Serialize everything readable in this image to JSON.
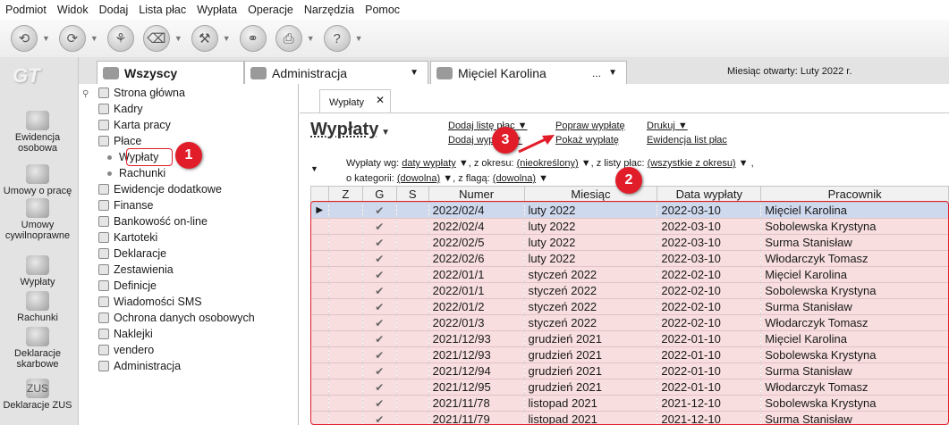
{
  "menu": [
    "Podmiot",
    "Widok",
    "Dodaj",
    "Lista płac",
    "Wypłata",
    "Operacje",
    "Narzędzia",
    "Pomoc"
  ],
  "toolbar_icons": [
    "back-icon",
    "forward-icon",
    "stamp-icon",
    "eraser-icon",
    "tools-icon",
    "link-icon",
    "printer-icon",
    "help-icon"
  ],
  "logo": "GT",
  "left_items": [
    "Ewidencja osobowa",
    "Umowy o pracę",
    "Umowy cywilnoprawne",
    "Wypłaty",
    "Rachunki",
    "Deklaracje skarbowe",
    "Deklaracje ZUS"
  ],
  "left_icon_texts": [
    "",
    "",
    "",
    "",
    "",
    "",
    "ZUS"
  ],
  "tabs": {
    "all": "Wszyscy",
    "admin": "Administracja",
    "person": "Mięciel Karolina",
    "person_more": "...",
    "month": "Miesiąc otwarty: Luty 2022 r."
  },
  "nav": [
    "Strona główna",
    "Kadry",
    "Karta pracy",
    "Płace",
    "Wypłaty",
    "Rachunki",
    "Ewidencje dodatkowe",
    "Finanse",
    "Bankowość on-line",
    "Kartoteki",
    "Deklaracje",
    "Zestawienia",
    "Definicje",
    "Wiadomości SMS",
    "Ochrona danych osobowych",
    "Naklejki",
    "vendero",
    "Administracja"
  ],
  "doc_tab": "Wypłaty",
  "page_title": "Wypłaty",
  "actions": {
    "add_list": "Dodaj listę płac",
    "add_pay": "Dodaj wypłatę",
    "fix_pay": "Popraw wypłatę",
    "show_pay": "Pokaż wypłatę",
    "print": "Drukuj",
    "registry": "Ewidencja list płac"
  },
  "filters": {
    "by_label": "Wypłaty wg:",
    "by_value": "daty wypłaty",
    "period_label": ", z okresu:",
    "period_value": "(nieokreślony)",
    "list_label": ", z listy płac:",
    "list_value": "(wszystkie z okresu)",
    "cat_label": "o kategorii:",
    "cat_value": "(dowolna)",
    "flag_label": ", z flagą:",
    "flag_value": "(dowolna)"
  },
  "columns": [
    "Z",
    "G",
    "S",
    "Numer",
    "Miesiąc",
    "Data wypłaty",
    "Pracownik"
  ],
  "rows": [
    [
      "2022/02/4",
      "luty 2022",
      "2022-03-10",
      "Mięciel Karolina"
    ],
    [
      "2022/02/4",
      "luty 2022",
      "2022-03-10",
      "Sobolewska Krystyna"
    ],
    [
      "2022/02/5",
      "luty 2022",
      "2022-03-10",
      "Surma Stanisław"
    ],
    [
      "2022/02/6",
      "luty 2022",
      "2022-03-10",
      "Włodarczyk Tomasz"
    ],
    [
      "2022/01/1",
      "styczeń 2022",
      "2022-02-10",
      "Mięciel Karolina"
    ],
    [
      "2022/01/1",
      "styczeń 2022",
      "2022-02-10",
      "Sobolewska Krystyna"
    ],
    [
      "2022/01/2",
      "styczeń 2022",
      "2022-02-10",
      "Surma Stanisław"
    ],
    [
      "2022/01/3",
      "styczeń 2022",
      "2022-02-10",
      "Włodarczyk Tomasz"
    ],
    [
      "2021/12/93",
      "grudzień 2021",
      "2022-01-10",
      "Mięciel Karolina"
    ],
    [
      "2021/12/93",
      "grudzień 2021",
      "2022-01-10",
      "Sobolewska Krystyna"
    ],
    [
      "2021/12/94",
      "grudzień 2021",
      "2022-01-10",
      "Surma Stanisław"
    ],
    [
      "2021/12/95",
      "grudzień 2021",
      "2022-01-10",
      "Włodarczyk Tomasz"
    ],
    [
      "2021/11/78",
      "listopad 2021",
      "2021-12-10",
      "Sobolewska Krystyna"
    ],
    [
      "2021/11/79",
      "listopad 2021",
      "2021-12-10",
      "Surma Stanisław"
    ]
  ],
  "check": "✔",
  "markers": [
    "1",
    "2",
    "3"
  ]
}
